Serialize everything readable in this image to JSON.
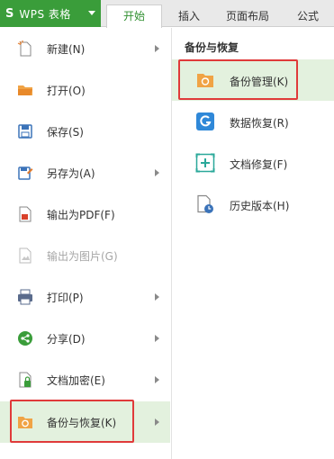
{
  "ribbon": {
    "app_logo": "S",
    "app_label": "WPS 表格",
    "tabs": [
      "开始",
      "插入",
      "页面布局",
      "公式"
    ]
  },
  "file_menu": {
    "items": [
      {
        "label": "新建(N)",
        "icon": "new-file-icon",
        "disabled": false,
        "submenu": true
      },
      {
        "label": "打开(O)",
        "icon": "open-folder-icon",
        "disabled": false,
        "submenu": false
      },
      {
        "label": "保存(S)",
        "icon": "save-icon",
        "disabled": false,
        "submenu": false
      },
      {
        "label": "另存为(A)",
        "icon": "save-as-icon",
        "disabled": false,
        "submenu": true
      },
      {
        "label": "输出为PDF(F)",
        "icon": "pdf-icon",
        "disabled": false,
        "submenu": false
      },
      {
        "label": "输出为图片(G)",
        "icon": "image-export-icon",
        "disabled": true,
        "submenu": false
      },
      {
        "label": "打印(P)",
        "icon": "printer-icon",
        "disabled": false,
        "submenu": true
      },
      {
        "label": "分享(D)",
        "icon": "share-icon",
        "disabled": false,
        "submenu": true
      },
      {
        "label": "文档加密(E)",
        "icon": "encrypt-icon",
        "disabled": false,
        "submenu": true
      },
      {
        "label": "备份与恢复(K)",
        "icon": "backup-restore-icon",
        "disabled": false,
        "submenu": true,
        "selected": true
      }
    ]
  },
  "submenu": {
    "title": "备份与恢复",
    "items": [
      {
        "label": "备份管理(K)",
        "icon": "backup-manage-icon",
        "selected": true
      },
      {
        "label": "数据恢复(R)",
        "icon": "data-recovery-icon",
        "selected": false
      },
      {
        "label": "文档修复(F)",
        "icon": "document-repair-icon",
        "selected": false
      },
      {
        "label": "历史版本(H)",
        "icon": "history-version-icon",
        "selected": false
      }
    ]
  },
  "colors": {
    "brand_green": "#3a9d3a",
    "selected_bg": "#e3f1de",
    "highlight_red": "#e03a3a"
  }
}
